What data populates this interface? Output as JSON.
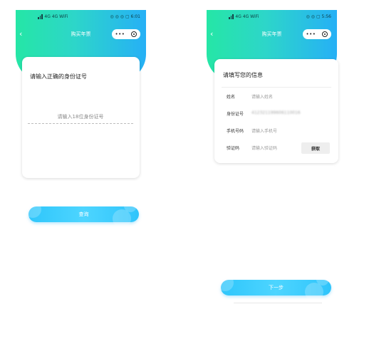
{
  "left": {
    "status": {
      "left": "4G 4G WiFi",
      "right": "◎ ◎ ◎ ▢ 6:01"
    },
    "nav": {
      "title": "购买年票"
    },
    "card": {
      "title": "请输入正确的身份证号",
      "input_placeholder": "请输入18位身份证号"
    },
    "button": {
      "label": "查询"
    }
  },
  "right": {
    "status": {
      "left": "4G 4G WiFi",
      "right": "◎ ◎ ▢ 5:56"
    },
    "nav": {
      "title": "购买年票"
    },
    "card": {
      "title": "请填写您的信息",
      "rows": [
        {
          "label": "姓名",
          "value": "请输入姓名"
        },
        {
          "label": "身份证号",
          "value": "412321199606110016"
        },
        {
          "label": "手机号码",
          "value": "请输入手机号"
        },
        {
          "label": "验证码",
          "value": "请输入验证码",
          "button": "获取"
        }
      ]
    },
    "button": {
      "label": "下一步"
    }
  },
  "colors": {
    "gradient_start": "#25e6a6",
    "gradient_end": "#26b0f6",
    "button": "#36c6fb"
  }
}
